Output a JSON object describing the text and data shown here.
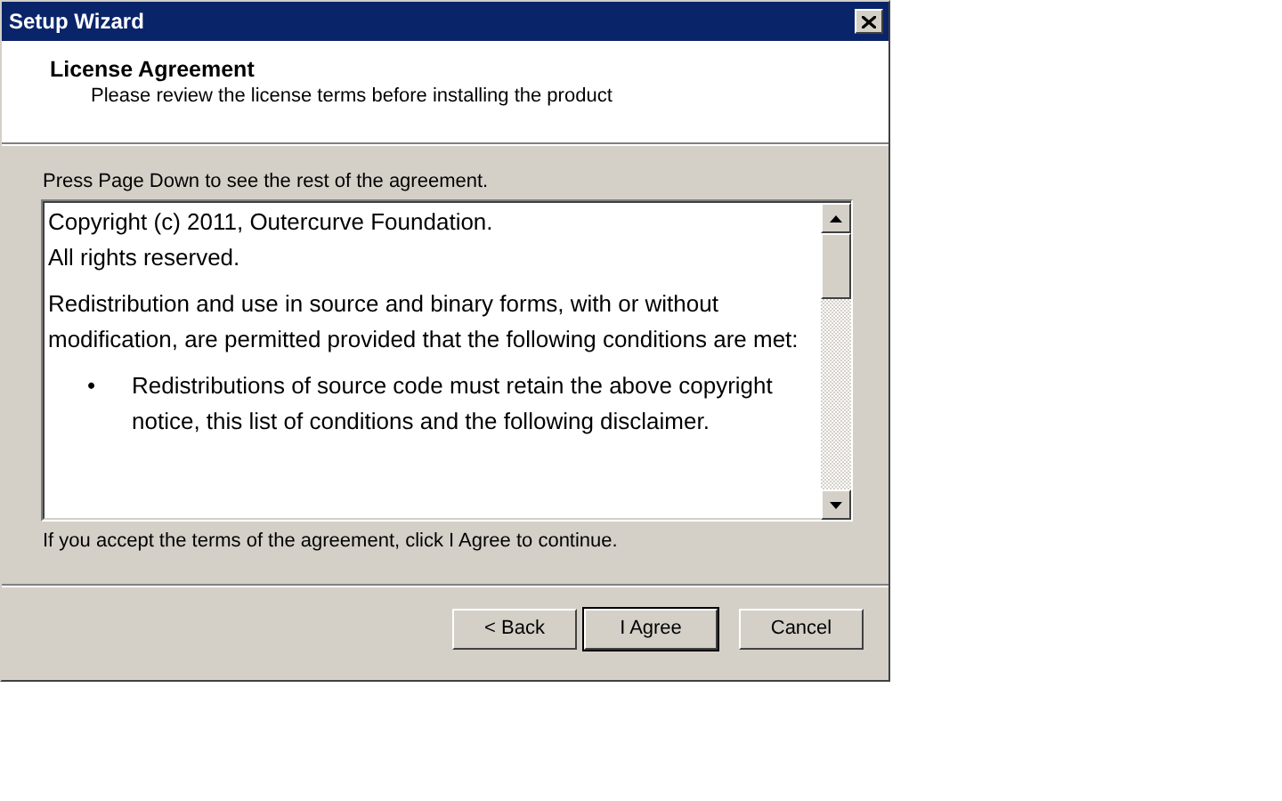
{
  "window": {
    "title": "Setup Wizard"
  },
  "header": {
    "title": "License Agreement",
    "subtitle": "Please review the license terms before installing the product"
  },
  "instruction": "Press Page Down to see the rest of the agreement.",
  "license": [
    {
      "kind": "line",
      "text": "Copyright (c) 2011, Outercurve Foundation."
    },
    {
      "kind": "line",
      "text": "All rights reserved."
    },
    {
      "kind": "paragraph",
      "text": "Redistribution and use in source and binary forms, with or without modification, are permitted provided that the following conditions are met:"
    },
    {
      "kind": "bullet",
      "bullet": "•",
      "text": "Redistributions of source code must retain the above copyright notice, this list of conditions and the following disclaimer."
    }
  ],
  "accept_note": "If you accept the terms of the agreement, click I Agree to continue.",
  "buttons": [
    {
      "label": "< Back",
      "default": false
    },
    {
      "label": "I Agree",
      "default": true
    },
    {
      "label": "Cancel",
      "default": false
    }
  ]
}
